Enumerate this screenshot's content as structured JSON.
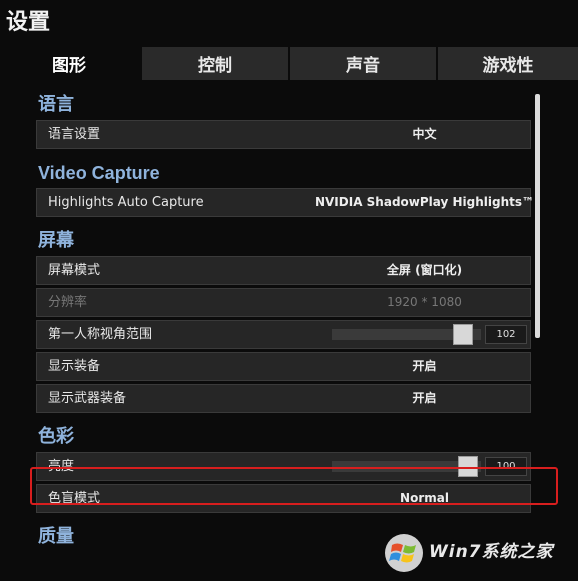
{
  "window": {
    "title": "设置"
  },
  "tabs": [
    {
      "label": "图形",
      "active": true
    },
    {
      "label": "控制"
    },
    {
      "label": "声音"
    },
    {
      "label": "游戏性"
    }
  ],
  "sections": {
    "language": {
      "title": "语言",
      "rows": {
        "language_setting": {
          "label": "语言设置",
          "value": "中文"
        }
      }
    },
    "video_capture": {
      "title": "Video Capture",
      "rows": {
        "highlights": {
          "label": "Highlights Auto Capture",
          "value": "NVIDIA ShadowPlay Highlights™"
        }
      }
    },
    "screen": {
      "title": "屏幕",
      "rows": {
        "screen_mode": {
          "label": "屏幕模式",
          "value": "全屏 (窗口化)"
        },
        "resolution": {
          "label": "分辨率",
          "value": "1920 * 1080"
        },
        "fov": {
          "label": "第一人称视角范围",
          "value": "102",
          "slider_fraction": 0.94
        },
        "show_gear": {
          "label": "显示装备",
          "value": "开启"
        },
        "show_weapon_gear": {
          "label": "显示武器装备",
          "value": "开启"
        }
      }
    },
    "color": {
      "title": "色彩",
      "rows": {
        "brightness": {
          "label": "亮度",
          "value": "100",
          "slider_fraction": 0.98
        },
        "colorblind": {
          "label": "色盲模式",
          "value": "Normal"
        }
      }
    },
    "quality": {
      "title": "质量"
    }
  },
  "watermark": {
    "text": "Win7系统之家",
    "icon": "windows-logo-icon"
  },
  "colors": {
    "highlight": "#d81e1e",
    "section_title": "#8fb3dc"
  }
}
